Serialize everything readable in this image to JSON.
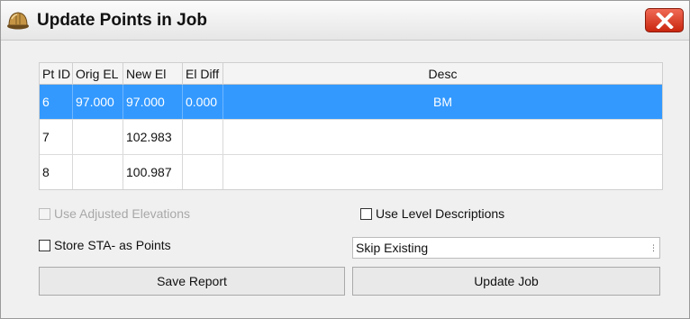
{
  "window": {
    "title": "Update Points in Job"
  },
  "icons": {
    "app": "hard-hat-icon",
    "close": "close-x-icon"
  },
  "colors": {
    "selection": "#3399ff",
    "close_button": "#d8341a"
  },
  "grid": {
    "columns": [
      "Pt ID",
      "Orig EL",
      "New El",
      "El Diff",
      "Desc"
    ],
    "rows": [
      {
        "pt_id": "6",
        "orig_el": "97.000",
        "new_el": "97.000",
        "el_diff": "0.000",
        "desc": "BM",
        "selected": true
      },
      {
        "pt_id": "7",
        "orig_el": "",
        "new_el": "102.983",
        "el_diff": "",
        "desc": "",
        "selected": false
      },
      {
        "pt_id": "8",
        "orig_el": "",
        "new_el": "100.987",
        "el_diff": "",
        "desc": "",
        "selected": false
      }
    ]
  },
  "options": {
    "use_adjusted_elevations": {
      "label": "Use Adjusted Elevations",
      "checked": false,
      "enabled": false
    },
    "use_level_descriptions": {
      "label": "Use Level Descriptions",
      "checked": false,
      "enabled": true
    },
    "store_sta_as_points": {
      "label": "Store STA- as Points",
      "checked": false,
      "enabled": true
    }
  },
  "existing_mode": {
    "selected": "Skip Existing"
  },
  "buttons": {
    "save_report": "Save Report",
    "update_job": "Update Job"
  }
}
